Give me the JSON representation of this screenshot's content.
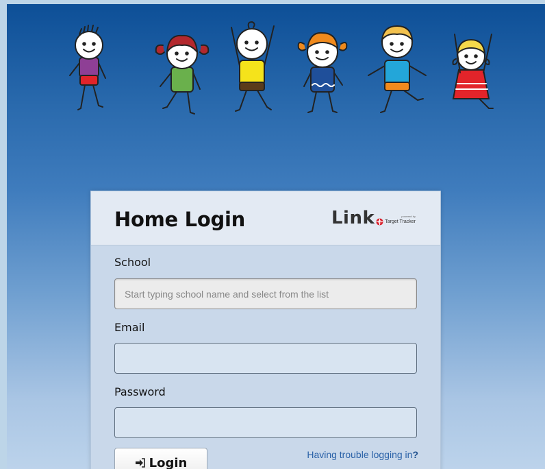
{
  "login": {
    "title": "Home Login",
    "brand": {
      "name": "Link",
      "powered_by": "powered by",
      "partner": "Target Tracker"
    },
    "school": {
      "label": "School",
      "placeholder": "Start typing school name and select from the list",
      "value": ""
    },
    "email": {
      "label": "Email",
      "value": ""
    },
    "password": {
      "label": "Password",
      "value": ""
    },
    "submit_label": "Login",
    "trouble_link": "Having trouble logging in",
    "trouble_q": "?"
  },
  "colors": {
    "sky_top": "#0d4f97",
    "sky_bottom": "#bcd3eb",
    "card_body": "#c9d8ea",
    "card_header": "#e3eaf3",
    "link": "#2b62a8",
    "brand_red": "#d9232e"
  },
  "icons": [
    "sign-in-icon",
    "target-tracker-logo-icon"
  ]
}
